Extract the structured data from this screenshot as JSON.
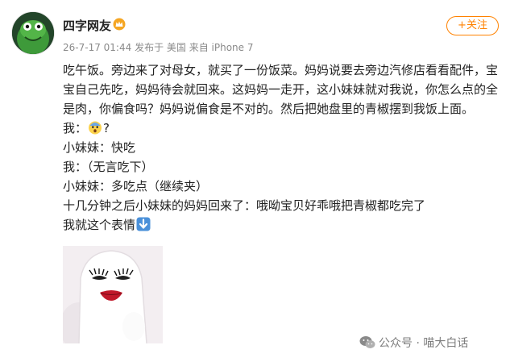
{
  "user": {
    "name": "四字网友",
    "avatar_icon": "green-creature-avatar",
    "badge_icon": "vip-crown-icon",
    "badge_color": "#f5a623"
  },
  "meta": {
    "timestamp": "26-7-17 01:44",
    "location": "发布于 美国",
    "device": "来自 iPhone 7"
  },
  "follow_button": {
    "label": "+关注",
    "color": "#ff8200"
  },
  "post": {
    "lines": [
      "吃午饭。旁边来了对母女，就买了一份饭菜。妈妈说要去旁边汽修店看看配件，宝",
      "宝自己先吃，妈妈待会就回来。这妈妈一走开，这小妹妹就对我说，你怎么点的全",
      "是肉，你偏食吗？妈妈说偏食是不对的。然后把她盘里的青椒摆到我饭上面。",
      "我：",
      "?",
      "小妹妹：快吃",
      "我：（无言吃下）",
      "小妹妹：多吃点（继续夹）",
      "十几分钟之后小妹妹的妈妈回来了：哦呦宝贝好乖哦把青椒都吃完了",
      "我就这个表情"
    ],
    "emoji_shocked": "shocked-face-emoji",
    "emoji_arrow": "down-arrow-emoji"
  },
  "meme": {
    "icon": "white-ghost-meme-face"
  },
  "watermark": {
    "text": "公众号 · 喵大白话",
    "icon": "wechat-icon"
  }
}
